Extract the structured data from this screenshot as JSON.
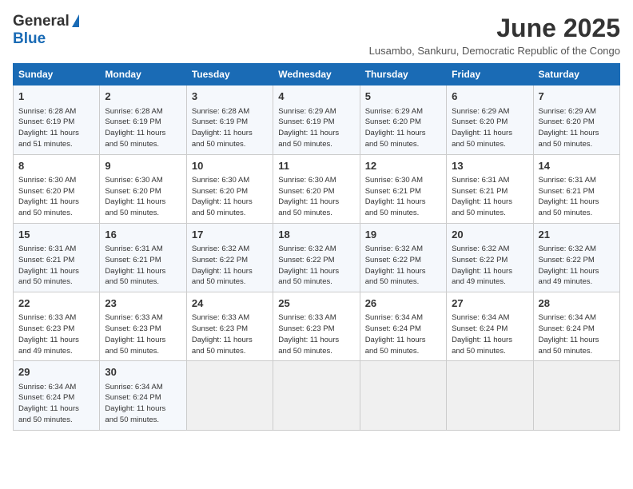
{
  "logo": {
    "general": "General",
    "blue": "Blue"
  },
  "title": "June 2025",
  "subtitle": "Lusambo, Sankuru, Democratic Republic of the Congo",
  "headers": [
    "Sunday",
    "Monday",
    "Tuesday",
    "Wednesday",
    "Thursday",
    "Friday",
    "Saturday"
  ],
  "weeks": [
    [
      {
        "day": "1",
        "info": "Sunrise: 6:28 AM\nSunset: 6:19 PM\nDaylight: 11 hours\nand 51 minutes."
      },
      {
        "day": "2",
        "info": "Sunrise: 6:28 AM\nSunset: 6:19 PM\nDaylight: 11 hours\nand 50 minutes."
      },
      {
        "day": "3",
        "info": "Sunrise: 6:28 AM\nSunset: 6:19 PM\nDaylight: 11 hours\nand 50 minutes."
      },
      {
        "day": "4",
        "info": "Sunrise: 6:29 AM\nSunset: 6:19 PM\nDaylight: 11 hours\nand 50 minutes."
      },
      {
        "day": "5",
        "info": "Sunrise: 6:29 AM\nSunset: 6:20 PM\nDaylight: 11 hours\nand 50 minutes."
      },
      {
        "day": "6",
        "info": "Sunrise: 6:29 AM\nSunset: 6:20 PM\nDaylight: 11 hours\nand 50 minutes."
      },
      {
        "day": "7",
        "info": "Sunrise: 6:29 AM\nSunset: 6:20 PM\nDaylight: 11 hours\nand 50 minutes."
      }
    ],
    [
      {
        "day": "8",
        "info": "Sunrise: 6:30 AM\nSunset: 6:20 PM\nDaylight: 11 hours\nand 50 minutes."
      },
      {
        "day": "9",
        "info": "Sunrise: 6:30 AM\nSunset: 6:20 PM\nDaylight: 11 hours\nand 50 minutes."
      },
      {
        "day": "10",
        "info": "Sunrise: 6:30 AM\nSunset: 6:20 PM\nDaylight: 11 hours\nand 50 minutes."
      },
      {
        "day": "11",
        "info": "Sunrise: 6:30 AM\nSunset: 6:20 PM\nDaylight: 11 hours\nand 50 minutes."
      },
      {
        "day": "12",
        "info": "Sunrise: 6:30 AM\nSunset: 6:21 PM\nDaylight: 11 hours\nand 50 minutes."
      },
      {
        "day": "13",
        "info": "Sunrise: 6:31 AM\nSunset: 6:21 PM\nDaylight: 11 hours\nand 50 minutes."
      },
      {
        "day": "14",
        "info": "Sunrise: 6:31 AM\nSunset: 6:21 PM\nDaylight: 11 hours\nand 50 minutes."
      }
    ],
    [
      {
        "day": "15",
        "info": "Sunrise: 6:31 AM\nSunset: 6:21 PM\nDaylight: 11 hours\nand 50 minutes."
      },
      {
        "day": "16",
        "info": "Sunrise: 6:31 AM\nSunset: 6:21 PM\nDaylight: 11 hours\nand 50 minutes."
      },
      {
        "day": "17",
        "info": "Sunrise: 6:32 AM\nSunset: 6:22 PM\nDaylight: 11 hours\nand 50 minutes."
      },
      {
        "day": "18",
        "info": "Sunrise: 6:32 AM\nSunset: 6:22 PM\nDaylight: 11 hours\nand 50 minutes."
      },
      {
        "day": "19",
        "info": "Sunrise: 6:32 AM\nSunset: 6:22 PM\nDaylight: 11 hours\nand 50 minutes."
      },
      {
        "day": "20",
        "info": "Sunrise: 6:32 AM\nSunset: 6:22 PM\nDaylight: 11 hours\nand 49 minutes."
      },
      {
        "day": "21",
        "info": "Sunrise: 6:32 AM\nSunset: 6:22 PM\nDaylight: 11 hours\nand 49 minutes."
      }
    ],
    [
      {
        "day": "22",
        "info": "Sunrise: 6:33 AM\nSunset: 6:23 PM\nDaylight: 11 hours\nand 49 minutes."
      },
      {
        "day": "23",
        "info": "Sunrise: 6:33 AM\nSunset: 6:23 PM\nDaylight: 11 hours\nand 50 minutes."
      },
      {
        "day": "24",
        "info": "Sunrise: 6:33 AM\nSunset: 6:23 PM\nDaylight: 11 hours\nand 50 minutes."
      },
      {
        "day": "25",
        "info": "Sunrise: 6:33 AM\nSunset: 6:23 PM\nDaylight: 11 hours\nand 50 minutes."
      },
      {
        "day": "26",
        "info": "Sunrise: 6:34 AM\nSunset: 6:24 PM\nDaylight: 11 hours\nand 50 minutes."
      },
      {
        "day": "27",
        "info": "Sunrise: 6:34 AM\nSunset: 6:24 PM\nDaylight: 11 hours\nand 50 minutes."
      },
      {
        "day": "28",
        "info": "Sunrise: 6:34 AM\nSunset: 6:24 PM\nDaylight: 11 hours\nand 50 minutes."
      }
    ],
    [
      {
        "day": "29",
        "info": "Sunrise: 6:34 AM\nSunset: 6:24 PM\nDaylight: 11 hours\nand 50 minutes."
      },
      {
        "day": "30",
        "info": "Sunrise: 6:34 AM\nSunset: 6:24 PM\nDaylight: 11 hours\nand 50 minutes."
      },
      {
        "day": "",
        "info": ""
      },
      {
        "day": "",
        "info": ""
      },
      {
        "day": "",
        "info": ""
      },
      {
        "day": "",
        "info": ""
      },
      {
        "day": "",
        "info": ""
      }
    ]
  ]
}
